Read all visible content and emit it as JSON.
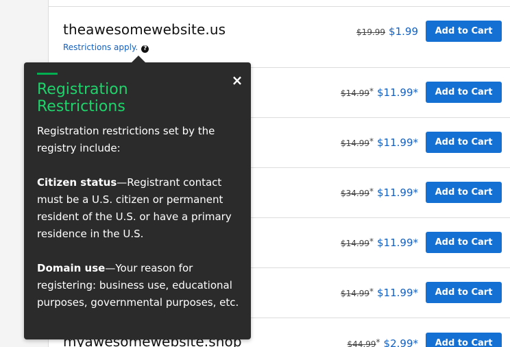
{
  "rows": [
    {
      "domain": "theawesomewebsite.us",
      "restrictions_label": "Restrictions apply.",
      "old_price": "$19.99",
      "old_asterisk": "",
      "new_price": "$1.99",
      "button_label": "Add to Cart"
    },
    {
      "domain": "",
      "old_price": "$14.99",
      "old_asterisk": "*",
      "new_price": "$11.99*",
      "button_label": "Add to Cart"
    },
    {
      "domain": "",
      "old_price": "$14.99",
      "old_asterisk": "*",
      "new_price": "$11.99*",
      "button_label": "Add to Cart"
    },
    {
      "domain": "",
      "old_price": "$34.99",
      "old_asterisk": "*",
      "new_price": "$11.99*",
      "button_label": "Add to Cart"
    },
    {
      "domain": "",
      "old_price": "$14.99",
      "old_asterisk": "*",
      "new_price": "$11.99*",
      "button_label": "Add to Cart"
    },
    {
      "domain": "",
      "old_price": "$14.99",
      "old_asterisk": "*",
      "new_price": "$11.99*",
      "button_label": "Add to Cart"
    },
    {
      "domain": "myawesomewebsite.shop",
      "old_price": "$44.99",
      "old_asterisk": "*",
      "new_price": "$2.99*",
      "button_label": "Add to Cart"
    }
  ],
  "tooltip": {
    "title_line1": "Registration",
    "title_line2": "Restrictions",
    "close_symbol": "×",
    "intro": "Registration restrictions set by the registry include:",
    "citizen_label": "Citizen status",
    "citizen_text": "—Registrant contact must be a U.S. citizen or permanent resident of the U.S. or have a primary residence in the U.S.",
    "domain_label": "Domain use",
    "domain_text": "—Your reason for registering: business use, educational purposes, governmental purposes, etc."
  },
  "help_icon": "question-circle-icon",
  "colors": {
    "accent_green": "#1fd36b",
    "button_blue": "#1570d3",
    "link_blue": "#1160c2",
    "tooltip_bg": "#2b2b2b"
  }
}
